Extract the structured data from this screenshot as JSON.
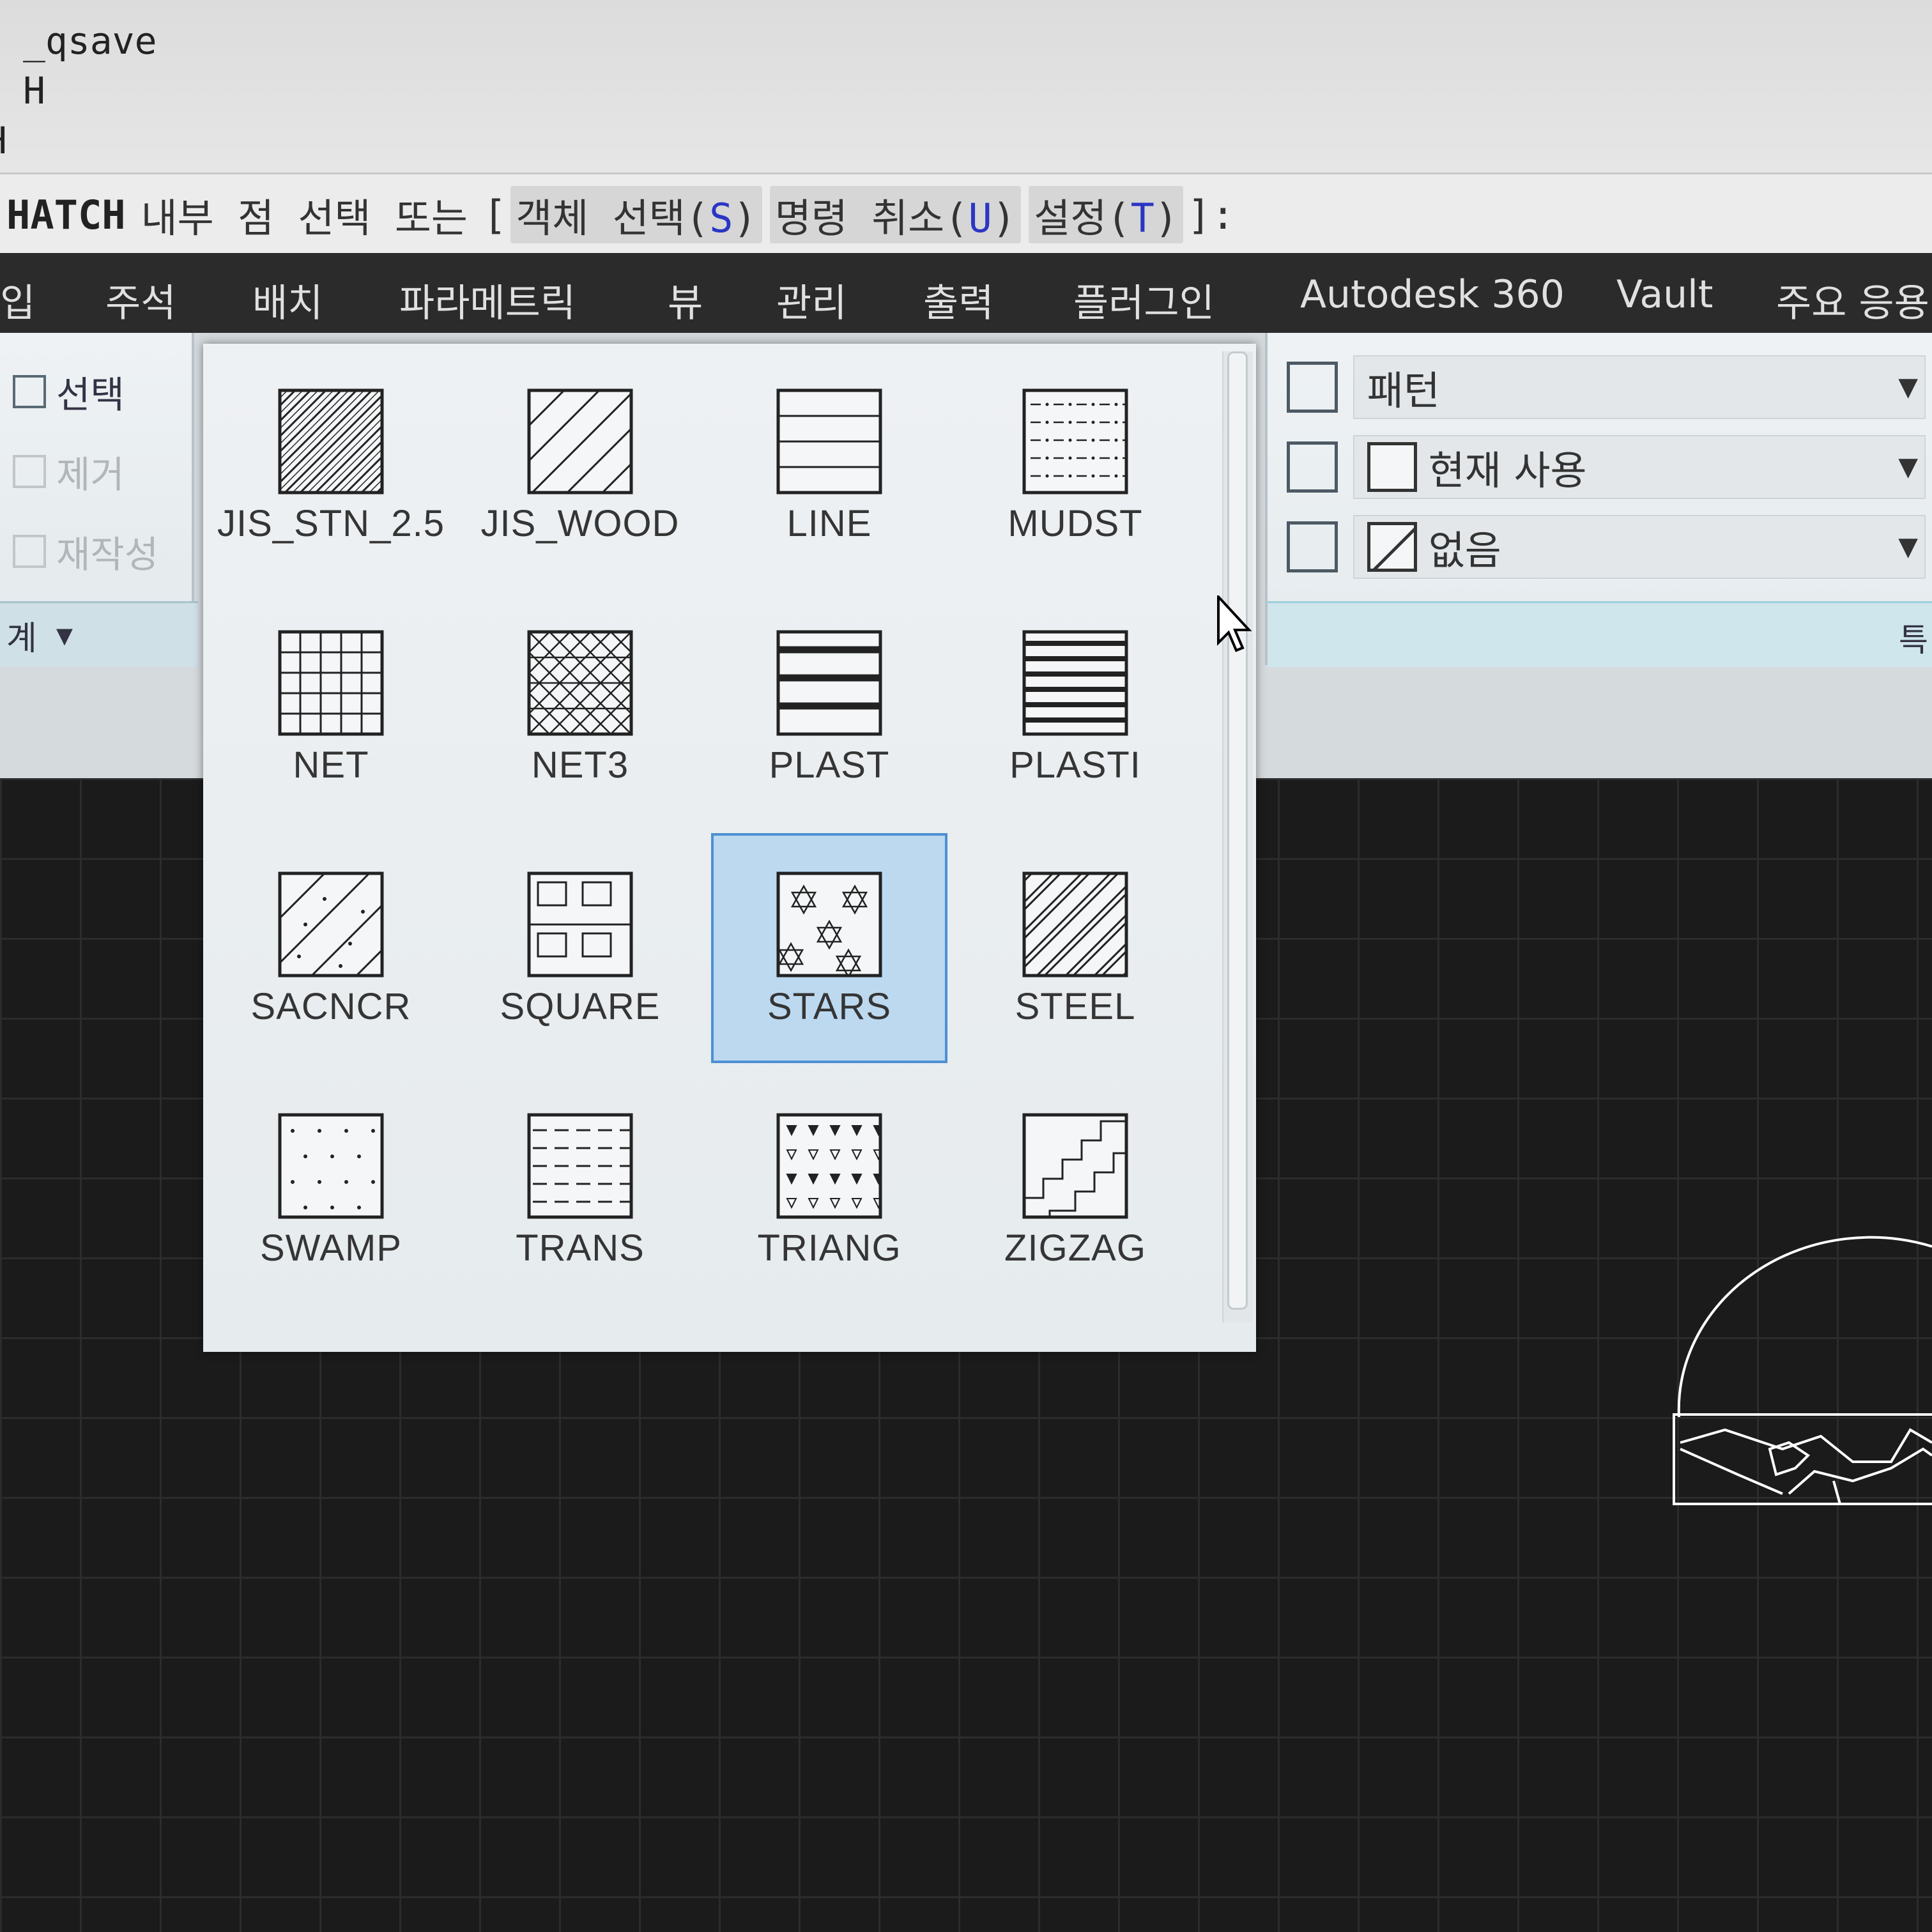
{
  "command_history": {
    "lines": [
      "_qsave",
      "H",
      "H"
    ]
  },
  "command_prompt": {
    "command": "HATCH",
    "prompt_text": "내부 점 선택 또는",
    "open_bracket": "[",
    "options": [
      {
        "label": "객체 선택(",
        "key": "S",
        "close": ")"
      },
      {
        "label": "명령 취소(",
        "key": "U",
        "close": ")"
      },
      {
        "label": "설정(",
        "key": "T",
        "close": ")"
      }
    ],
    "close_bracket": "]:"
  },
  "ribbon_tabs": [
    "입",
    "주석",
    "배치",
    "파라메트릭",
    "뷰",
    "관리",
    "출력",
    "플러그인",
    "Autodesk 360",
    "Vault",
    "주요 응용"
  ],
  "boundaries_panel": {
    "select_label": "선택",
    "remove_label": "제거",
    "recreate_label": "재작성",
    "footer_label": "계",
    "footer_arrow": "▾"
  },
  "properties_panel": {
    "pattern_type": "패턴",
    "color": "현재 사용",
    "background": "없음",
    "footer_label": "특"
  },
  "pattern_gallery": {
    "items": [
      {
        "name": "JIS_STN_2.5",
        "pattern": "diag-dense"
      },
      {
        "name": "JIS_WOOD",
        "pattern": "diag-sparse"
      },
      {
        "name": "LINE",
        "pattern": "horizontal"
      },
      {
        "name": "MUDST",
        "pattern": "dashes-dots"
      },
      {
        "name": "NET",
        "pattern": "grid"
      },
      {
        "name": "NET3",
        "pattern": "cross-hatch"
      },
      {
        "name": "PLAST",
        "pattern": "thick-bands"
      },
      {
        "name": "PLASTI",
        "pattern": "thick-lines"
      },
      {
        "name": "SACNCR",
        "pattern": "diag-dots"
      },
      {
        "name": "SQUARE",
        "pattern": "squares"
      },
      {
        "name": "STARS",
        "pattern": "stars"
      },
      {
        "name": "STEEL",
        "pattern": "diag-double"
      },
      {
        "name": "SWAMP",
        "pattern": "sparse-dots"
      },
      {
        "name": "TRANS",
        "pattern": "dashed-lines"
      },
      {
        "name": "TRIANG",
        "pattern": "triangles"
      },
      {
        "name": "ZIGZAG",
        "pattern": "zigzag"
      }
    ],
    "selected": "STARS"
  },
  "colors": {
    "tab_bar": "#2b2b2b",
    "drawing_bg": "#1b1b1b",
    "selection": "#bcd9f0",
    "selection_border": "#4d90d3",
    "command_key": "#2a36c4"
  }
}
